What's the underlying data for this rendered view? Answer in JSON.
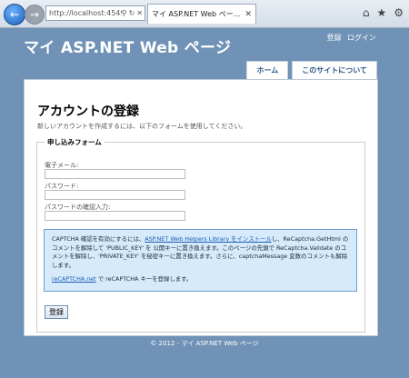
{
  "browser": {
    "url": "http://localhost:4549/",
    "tab_title": "マイ ASP.NET Web ペー..."
  },
  "header": {
    "site_title": "マイ ASP.NET Web ページ",
    "register_link": "登録",
    "login_link": "ログイン"
  },
  "menu": {
    "home": "ホーム",
    "about": "このサイトについて"
  },
  "content": {
    "title": "アカウントの登録",
    "subtitle": "新しいアカウントを作成するには、以下のフォームを使用してください。",
    "legend": "申し込みフォーム",
    "email_label": "電子メール:",
    "password_label": "パスワード:",
    "confirm_label": "パスワードの確認入力:",
    "captcha": {
      "pre": "CAPTCHA 確認を有効にするには、",
      "link1": "ASP.NET Web Helpers Library をインストール",
      "post": "し、ReCaptcha.GetHtml のコメントを解除して 'PUBLIC_KEY' を 公開キーに置き換えます。このページの先頭で ReCaptcha.Validate のコメントを解除し、'PRIVATE_KEY' を秘密キーに置き換えます。さらに、captchaMessage 変数のコメントも解除します。",
      "link2": "reCAPTCHA.net",
      "line2": " で reCAPTCHA キーを登録します。"
    },
    "submit": "登録"
  },
  "footer": "© 2012 - マイ ASP.NET Web ページ"
}
